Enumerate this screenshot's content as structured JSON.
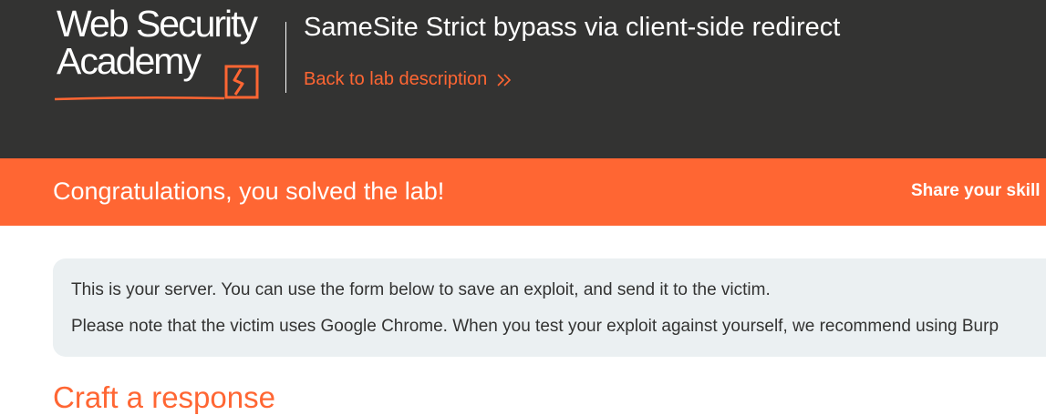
{
  "header": {
    "logo_line1": "Web Security",
    "logo_line2": "Academy",
    "lab_title": "SameSite Strict bypass via client-side redirect",
    "back_link": "Back to lab description"
  },
  "banner": {
    "message": "Congratulations, you solved the lab!",
    "share": "Share your skill"
  },
  "info": {
    "line1": "This is your server. You can use the form below to save an exploit, and send it to the victim.",
    "line2": "Please note that the victim uses Google Chrome. When you test your exploit against yourself, we recommend using Burp"
  },
  "main": {
    "heading": "Craft a response"
  },
  "colors": {
    "header_bg": "#333332",
    "accent": "#ff6633",
    "info_bg": "#ebf0f2"
  },
  "icons": [
    "academy-logo-mark",
    "double-chevron-right-icon"
  ]
}
